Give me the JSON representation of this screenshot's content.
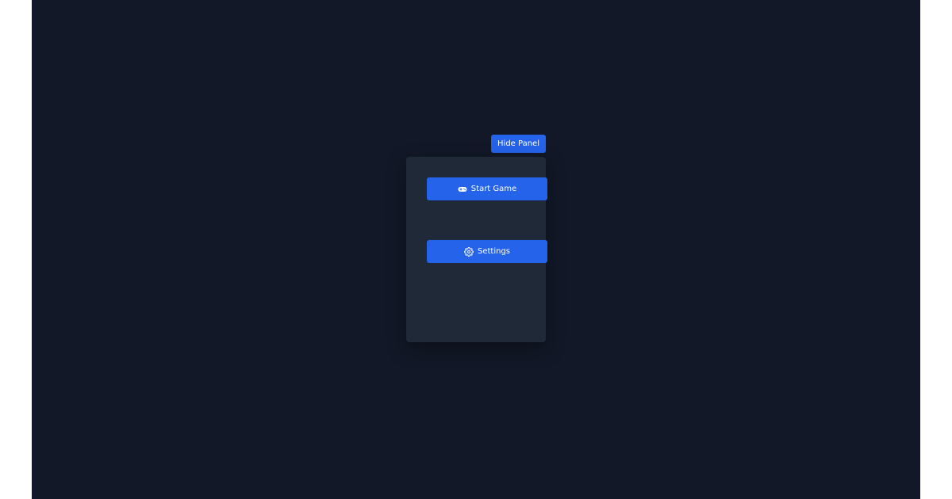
{
  "panel_toggle": {
    "label": "Hide Panel"
  },
  "menu": {
    "items": [
      {
        "label": "Start Game",
        "icon": "gamepad-icon"
      },
      {
        "label": "Settings",
        "icon": "gear-icon"
      }
    ]
  },
  "colors": {
    "background": "#121827",
    "panel": "#1f2937",
    "accent": "#2563eb",
    "text": "#ffffff"
  }
}
